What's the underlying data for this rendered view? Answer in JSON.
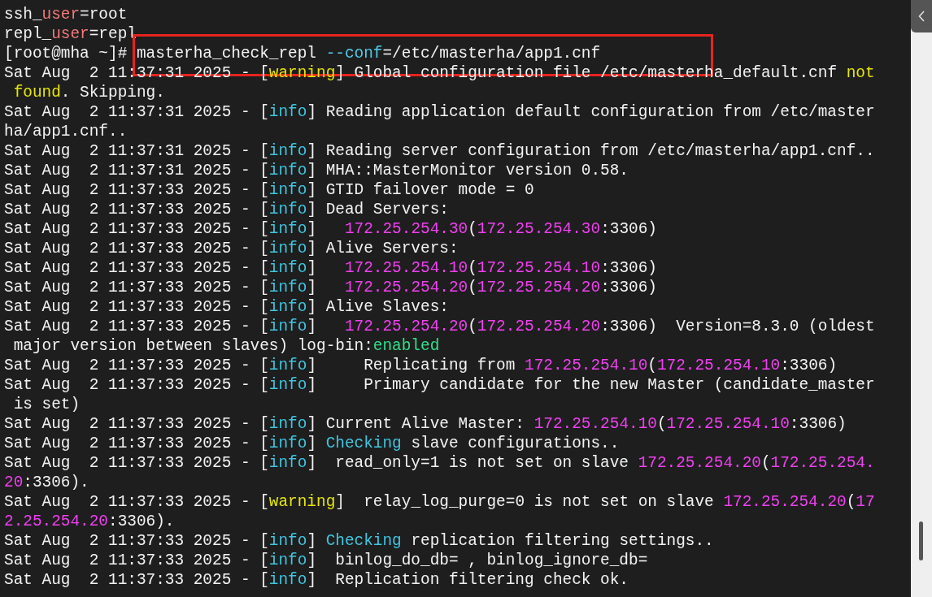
{
  "terminal": {
    "lines": [
      {
        "boxed": false,
        "segments": [
          {
            "kind": "text",
            "text": "ssh_"
          },
          {
            "kind": "user",
            "text": "user"
          },
          {
            "kind": "text",
            "text": "=root"
          }
        ]
      },
      {
        "boxed": false,
        "segments": [
          {
            "kind": "text",
            "text": "repl_"
          },
          {
            "kind": "user",
            "text": "user"
          },
          {
            "kind": "text",
            "text": "=repl"
          }
        ]
      },
      {
        "boxed": true,
        "segments": [
          {
            "kind": "text",
            "text": "[root@mha ~]# masterha_check_repl "
          },
          {
            "kind": "option",
            "text": "--conf"
          },
          {
            "kind": "text",
            "text": "=/etc/masterha/app1.cnf"
          }
        ]
      },
      {
        "boxed": false,
        "segments": [
          {
            "kind": "text",
            "text": "Sat Aug  2 11:37:31 2025 - ["
          },
          {
            "kind": "warning",
            "text": "warning"
          },
          {
            "kind": "text",
            "text": "] Global configuration file /etc/masterha_default.cnf "
          },
          {
            "kind": "warning",
            "text": "not"
          }
        ]
      },
      {
        "boxed": false,
        "segments": [
          {
            "kind": "warning",
            "text": " found"
          },
          {
            "kind": "text",
            "text": ". Skipping."
          }
        ]
      },
      {
        "boxed": false,
        "segments": [
          {
            "kind": "text",
            "text": "Sat Aug  2 11:37:31 2025 - ["
          },
          {
            "kind": "info",
            "text": "info"
          },
          {
            "kind": "text",
            "text": "] Reading application default configuration from /etc/master"
          }
        ]
      },
      {
        "boxed": false,
        "segments": [
          {
            "kind": "text",
            "text": "ha/app1.cnf.."
          }
        ]
      },
      {
        "boxed": false,
        "segments": [
          {
            "kind": "text",
            "text": "Sat Aug  2 11:37:31 2025 - ["
          },
          {
            "kind": "info",
            "text": "info"
          },
          {
            "kind": "text",
            "text": "] Reading server configuration from /etc/masterha/app1.cnf.."
          }
        ]
      },
      {
        "boxed": false,
        "segments": [
          {
            "kind": "text",
            "text": "Sat Aug  2 11:37:31 2025 - ["
          },
          {
            "kind": "info",
            "text": "info"
          },
          {
            "kind": "text",
            "text": "] MHA::MasterMonitor version 0.58."
          }
        ]
      },
      {
        "boxed": false,
        "segments": [
          {
            "kind": "text",
            "text": "Sat Aug  2 11:37:33 2025 - ["
          },
          {
            "kind": "info",
            "text": "info"
          },
          {
            "kind": "text",
            "text": "] GTID failover mode = 0"
          }
        ]
      },
      {
        "boxed": false,
        "segments": [
          {
            "kind": "text",
            "text": "Sat Aug  2 11:37:33 2025 - ["
          },
          {
            "kind": "info",
            "text": "info"
          },
          {
            "kind": "text",
            "text": "] Dead Servers:"
          }
        ]
      },
      {
        "boxed": false,
        "segments": [
          {
            "kind": "text",
            "text": "Sat Aug  2 11:37:33 2025 - ["
          },
          {
            "kind": "info",
            "text": "info"
          },
          {
            "kind": "text",
            "text": "]   "
          },
          {
            "kind": "ip",
            "text": "172.25.254.30"
          },
          {
            "kind": "text",
            "text": "("
          },
          {
            "kind": "ip",
            "text": "172.25.254.30"
          },
          {
            "kind": "text",
            "text": ":3306)"
          }
        ]
      },
      {
        "boxed": false,
        "segments": [
          {
            "kind": "text",
            "text": "Sat Aug  2 11:37:33 2025 - ["
          },
          {
            "kind": "info",
            "text": "info"
          },
          {
            "kind": "text",
            "text": "] Alive Servers:"
          }
        ]
      },
      {
        "boxed": false,
        "segments": [
          {
            "kind": "text",
            "text": "Sat Aug  2 11:37:33 2025 - ["
          },
          {
            "kind": "info",
            "text": "info"
          },
          {
            "kind": "text",
            "text": "]   "
          },
          {
            "kind": "ip",
            "text": "172.25.254.10"
          },
          {
            "kind": "text",
            "text": "("
          },
          {
            "kind": "ip",
            "text": "172.25.254.10"
          },
          {
            "kind": "text",
            "text": ":3306)"
          }
        ]
      },
      {
        "boxed": false,
        "segments": [
          {
            "kind": "text",
            "text": "Sat Aug  2 11:37:33 2025 - ["
          },
          {
            "kind": "info",
            "text": "info"
          },
          {
            "kind": "text",
            "text": "]   "
          },
          {
            "kind": "ip",
            "text": "172.25.254.20"
          },
          {
            "kind": "text",
            "text": "("
          },
          {
            "kind": "ip",
            "text": "172.25.254.20"
          },
          {
            "kind": "text",
            "text": ":3306)"
          }
        ]
      },
      {
        "boxed": false,
        "segments": [
          {
            "kind": "text",
            "text": "Sat Aug  2 11:37:33 2025 - ["
          },
          {
            "kind": "info",
            "text": "info"
          },
          {
            "kind": "text",
            "text": "] Alive Slaves:"
          }
        ]
      },
      {
        "boxed": false,
        "segments": [
          {
            "kind": "text",
            "text": "Sat Aug  2 11:37:33 2025 - ["
          },
          {
            "kind": "info",
            "text": "info"
          },
          {
            "kind": "text",
            "text": "]   "
          },
          {
            "kind": "ip",
            "text": "172.25.254.20"
          },
          {
            "kind": "text",
            "text": "("
          },
          {
            "kind": "ip",
            "text": "172.25.254.20"
          },
          {
            "kind": "text",
            "text": ":3306)  Version=8.3.0 (oldest"
          }
        ]
      },
      {
        "boxed": false,
        "segments": [
          {
            "kind": "text",
            "text": " major version between slaves) log-bin:"
          },
          {
            "kind": "enabled",
            "text": "enabled"
          }
        ]
      },
      {
        "boxed": false,
        "segments": [
          {
            "kind": "text",
            "text": "Sat Aug  2 11:37:33 2025 - ["
          },
          {
            "kind": "info",
            "text": "info"
          },
          {
            "kind": "text",
            "text": "]     Replicating from "
          },
          {
            "kind": "ip",
            "text": "172.25.254.10"
          },
          {
            "kind": "text",
            "text": "("
          },
          {
            "kind": "ip",
            "text": "172.25.254.10"
          },
          {
            "kind": "text",
            "text": ":3306)"
          }
        ]
      },
      {
        "boxed": false,
        "segments": [
          {
            "kind": "text",
            "text": "Sat Aug  2 11:37:33 2025 - ["
          },
          {
            "kind": "info",
            "text": "info"
          },
          {
            "kind": "text",
            "text": "]     Primary candidate for the new Master (candidate_master"
          }
        ]
      },
      {
        "boxed": false,
        "segments": [
          {
            "kind": "text",
            "text": " is set)"
          }
        ]
      },
      {
        "boxed": false,
        "segments": [
          {
            "kind": "text",
            "text": "Sat Aug  2 11:37:33 2025 - ["
          },
          {
            "kind": "info",
            "text": "info"
          },
          {
            "kind": "text",
            "text": "] Current Alive Master: "
          },
          {
            "kind": "ip",
            "text": "172.25.254.10"
          },
          {
            "kind": "text",
            "text": "("
          },
          {
            "kind": "ip",
            "text": "172.25.254.10"
          },
          {
            "kind": "text",
            "text": ":3306)"
          }
        ]
      },
      {
        "boxed": false,
        "segments": [
          {
            "kind": "text",
            "text": "Sat Aug  2 11:37:33 2025 - ["
          },
          {
            "kind": "info",
            "text": "info"
          },
          {
            "kind": "text",
            "text": "] "
          },
          {
            "kind": "info",
            "text": "Checking"
          },
          {
            "kind": "text",
            "text": " slave configurations.."
          }
        ]
      },
      {
        "boxed": false,
        "segments": [
          {
            "kind": "text",
            "text": "Sat Aug  2 11:37:33 2025 - ["
          },
          {
            "kind": "info",
            "text": "info"
          },
          {
            "kind": "text",
            "text": "]  read_only=1 is not set on slave "
          },
          {
            "kind": "ip",
            "text": "172.25.254.20"
          },
          {
            "kind": "text",
            "text": "("
          },
          {
            "kind": "ip",
            "text": "172.25.254."
          }
        ]
      },
      {
        "boxed": false,
        "segments": [
          {
            "kind": "ip",
            "text": "20"
          },
          {
            "kind": "text",
            "text": ":3306)."
          }
        ]
      },
      {
        "boxed": false,
        "segments": [
          {
            "kind": "text",
            "text": "Sat Aug  2 11:37:33 2025 - ["
          },
          {
            "kind": "warning",
            "text": "warning"
          },
          {
            "kind": "text",
            "text": "]  relay_log_purge=0 is not set on slave "
          },
          {
            "kind": "ip",
            "text": "172.25.254.20"
          },
          {
            "kind": "text",
            "text": "("
          },
          {
            "kind": "ip",
            "text": "17"
          }
        ]
      },
      {
        "boxed": false,
        "segments": [
          {
            "kind": "ip",
            "text": "2.25.254.20"
          },
          {
            "kind": "text",
            "text": ":3306)."
          }
        ]
      },
      {
        "boxed": false,
        "segments": [
          {
            "kind": "text",
            "text": "Sat Aug  2 11:37:33 2025 - ["
          },
          {
            "kind": "info",
            "text": "info"
          },
          {
            "kind": "text",
            "text": "] "
          },
          {
            "kind": "info",
            "text": "Checking"
          },
          {
            "kind": "text",
            "text": " replication filtering settings.."
          }
        ]
      },
      {
        "boxed": false,
        "segments": [
          {
            "kind": "text",
            "text": "Sat Aug  2 11:37:33 2025 - ["
          },
          {
            "kind": "info",
            "text": "info"
          },
          {
            "kind": "text",
            "text": "]  binlog_do_db= , binlog_ignore_db="
          }
        ]
      },
      {
        "boxed": false,
        "segments": [
          {
            "kind": "text",
            "text": "Sat Aug  2 11:37:33 2025 - ["
          },
          {
            "kind": "info",
            "text": "info"
          },
          {
            "kind": "text",
            "text": "]  Replication filtering check ok."
          }
        ]
      }
    ]
  }
}
